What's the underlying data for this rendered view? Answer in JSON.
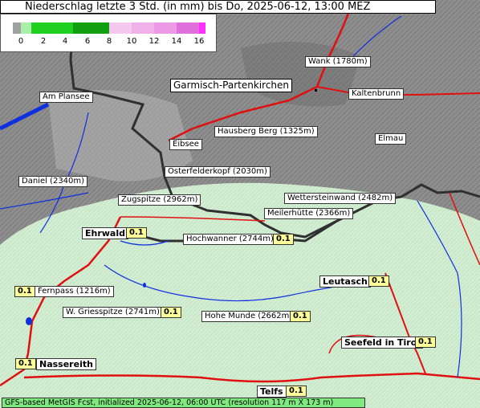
{
  "title": "Niederschlag letzte 3 Std. (in mm) bis Do, 2025-06-12, 13:00 MEZ",
  "legend": {
    "ticks": [
      "0",
      "2",
      "4",
      "6",
      "8",
      "10",
      "12",
      "14",
      "16"
    ],
    "colors": [
      "#f0f0f0",
      "#a8f0a8",
      "#20d020",
      "#10a010",
      "#087808",
      "#f5c8f0",
      "#ec9ae6",
      "#e070dc",
      "#ff30ff"
    ]
  },
  "places": {
    "garmisch": "Garmisch-Partenkirchen",
    "wank": "Wank (1780m)",
    "kaltenbrunn": "Kaltenbrunn",
    "am_plansee": "Am Plansee",
    "hausberg": "Hausberg Berg (1325m)",
    "eibsee": "Eibsee",
    "elmau": "Elmau",
    "osterfelderkopf": "Osterfelderkopf (2030m)",
    "daniel": "Daniel (2340m)",
    "zugspitze": "Zugspitze (2962m)",
    "wettersteinwand": "Wettersteinwand (2482m)",
    "meilerhuette": "Meilerhütte (2366m)",
    "ehrwald": "Ehrwald",
    "hochwanner": "Hochwanner (2744m)",
    "fernpass": "Fernpass (1216m)",
    "leutasch": "Leutasch",
    "w_griesspitze": "W. Griesspitze (2741m)",
    "hohe_munde": "Hohe Munde (2662m)",
    "seefeld": "Seefeld in Tirol",
    "nassereith": "Nassereith",
    "telfs": "Telfs"
  },
  "values": {
    "ehrwald": "0.1",
    "hochwanner": "0.1",
    "fernpass": "0.1",
    "leutasch": "0.1",
    "w_griesspitze": "0.1",
    "hohe_munde": "0.1",
    "seefeld": "0.1",
    "nassereith": "0.1",
    "telfs": "0.1"
  },
  "footer": "GFS-based MetGIS Fcst, initialized 2025-06-12, 06:00 UTC  (resolution 117 m X 173 m)",
  "colors": {
    "terrain": "#8a8a8a",
    "precip_light": "#d6f5d6",
    "road": "#e01010",
    "river": "#1030e0",
    "border": "#303030",
    "value_bg": "#ffff99"
  }
}
